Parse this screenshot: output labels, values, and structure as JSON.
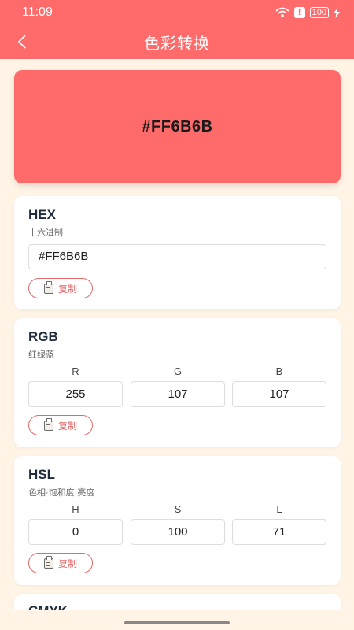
{
  "status": {
    "time": "11:09",
    "battery": "100"
  },
  "header": {
    "title": "色彩转换"
  },
  "preview": {
    "hex": "#FF6B6B",
    "color": "#FF6B6B"
  },
  "hex_card": {
    "title": "HEX",
    "subtitle": "十六进制",
    "value": "#FF6B6B",
    "copy_label": "复制"
  },
  "rgb_card": {
    "title": "RGB",
    "subtitle": "红绿蓝",
    "labels": [
      "R",
      "G",
      "B"
    ],
    "values": [
      "255",
      "107",
      "107"
    ],
    "copy_label": "复制"
  },
  "hsl_card": {
    "title": "HSL",
    "subtitle": "色相·饱和度·亮度",
    "labels": [
      "H",
      "S",
      "L"
    ],
    "values": [
      "0",
      "100",
      "71"
    ],
    "copy_label": "复制"
  },
  "cmyk_card": {
    "title": "CMYK"
  },
  "colors": {
    "accent": "#FF6B6B",
    "background": "#FFF4E6",
    "outline": "#E46A6A"
  }
}
